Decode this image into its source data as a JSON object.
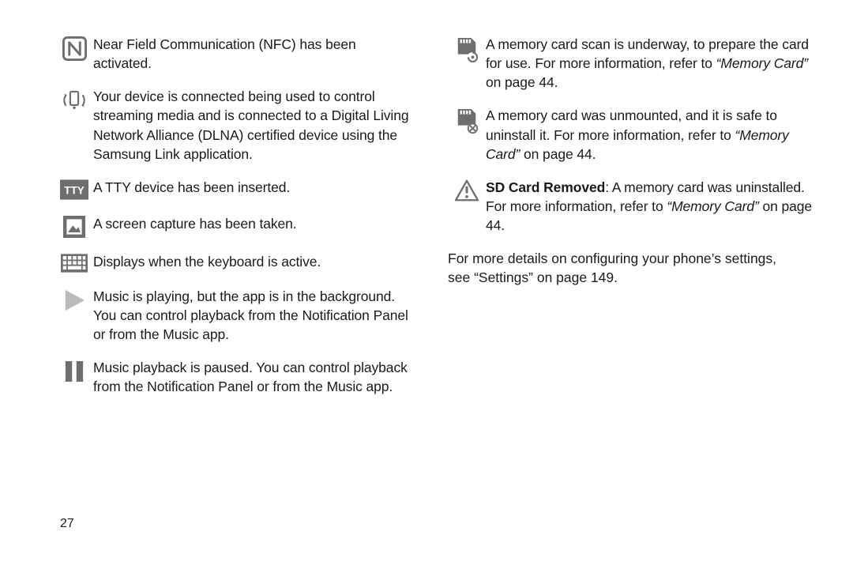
{
  "page_number": "27",
  "left": {
    "nfc": "Near Field Communication (NFC) has been activated.",
    "dlna": "Your device is connected being used to control streaming media and is connected to a Digital Living Network Alliance (DLNA) certified device using the Samsung Link application.",
    "tty": "A TTY device has been inserted.",
    "screenshot": "A screen capture has been taken.",
    "keyboard": "Displays when the keyboard is active.",
    "music_play": "Music is playing, but the app is in the background. You can control playback from the Notification Panel or from the Music app.",
    "music_pause": "Music playback is paused. You can control playback from the Notification Panel or from the Music app."
  },
  "right": {
    "sd_scan_a": "A memory card scan is underway, to prepare the card for use. For more information, refer to ",
    "sd_scan_ref": "“Memory Card”",
    "sd_scan_b": " on page 44.",
    "sd_unmount_a": "A memory card was unmounted, and it is safe to uninstall it. For more information, refer to ",
    "sd_unmount_ref": "“Memory Card”",
    "sd_unmount_b": " on page 44.",
    "sd_removed_bold": "SD Card Removed",
    "sd_removed_a": ": A memory card was uninstalled. For more information, refer to ",
    "sd_removed_ref": "“Memory Card”",
    "sd_removed_b": " on page 44.",
    "footer_a": "For more details on configuring your phone’s settings, see ",
    "footer_ref": "“Settings”",
    "footer_b": " on page 149."
  }
}
